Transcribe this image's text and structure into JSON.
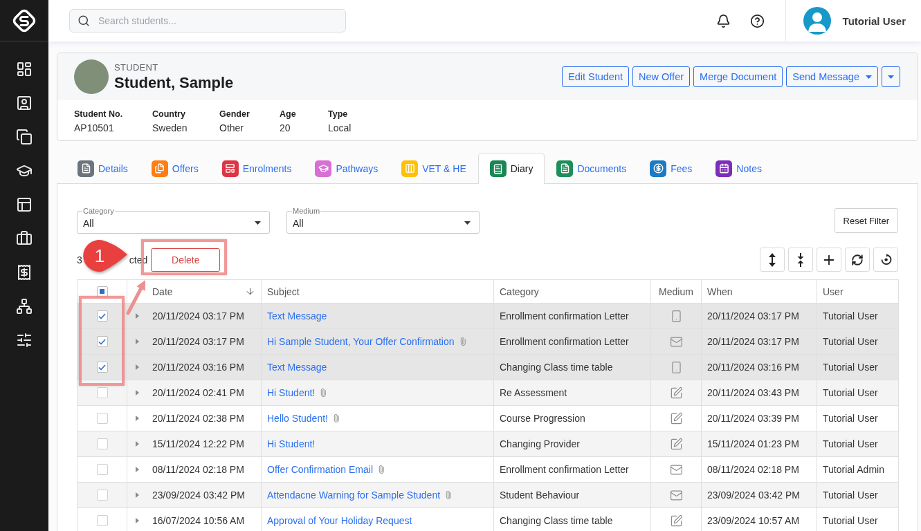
{
  "search": {
    "placeholder": "Search students..."
  },
  "user": {
    "name": "Tutorial User"
  },
  "student": {
    "label": "STUDENT",
    "name": "Student, Sample",
    "actions": [
      {
        "kind": "button",
        "label": "Edit Student"
      },
      {
        "kind": "button",
        "label": "New Offer"
      },
      {
        "kind": "button",
        "label": "Merge Document"
      },
      {
        "kind": "dropdown",
        "label": "Send Message"
      },
      {
        "kind": "toggle"
      }
    ],
    "fields": [
      {
        "label": "Student No.",
        "value": "AP10501"
      },
      {
        "label": "Country",
        "value": "Sweden"
      },
      {
        "label": "Gender",
        "value": "Other"
      },
      {
        "label": "Age",
        "value": "20"
      },
      {
        "label": "Type",
        "value": "Local"
      }
    ]
  },
  "tabs": [
    {
      "label": "Details",
      "selected": false,
      "color": "#6c757d"
    },
    {
      "label": "Offers",
      "selected": false,
      "color": "#fd7e14"
    },
    {
      "label": "Enrolments",
      "selected": false,
      "color": "#dc3545"
    },
    {
      "label": "Pathways",
      "selected": false,
      "color": "#d86fd3"
    },
    {
      "label": "VET & HE",
      "selected": false,
      "color": "#ffc107"
    },
    {
      "label": "Diary",
      "selected": true,
      "color": "#198754"
    },
    {
      "label": "Documents",
      "selected": false,
      "color": "#1e8e5a"
    },
    {
      "label": "Fees",
      "selected": false,
      "color": "#1b7cc4"
    },
    {
      "label": "Notes",
      "selected": false,
      "color": "#7d2eb8"
    }
  ],
  "filters": {
    "selects": [
      {
        "label": "Category",
        "value": "All"
      },
      {
        "label": "Medium",
        "value": "All"
      }
    ],
    "reset_label": "Reset Filter"
  },
  "selection": {
    "count": "3",
    "label_fragment": "cted"
  },
  "delete_label": "Delete",
  "annotation": {
    "step": "1"
  },
  "table": {
    "select_all": {
      "indeterminate": true
    },
    "columns": [
      {
        "label": "Date",
        "sorted": true
      },
      {
        "label": "Subject",
        "sorted": false
      },
      {
        "label": "Category",
        "sorted": false
      },
      {
        "label": "Medium",
        "sorted": false
      },
      {
        "label": "When",
        "sorted": false
      },
      {
        "label": "User",
        "sorted": false
      }
    ],
    "rows": [
      {
        "checked": true,
        "date": "20/11/2024 03:17 PM",
        "subject": "Text Message",
        "attachment": false,
        "category": "Enrollment confirmation Letter",
        "medium": {
          "kind": "phone"
        },
        "when": "20/11/2024 03:17 PM",
        "user": "Tutorial User"
      },
      {
        "checked": true,
        "date": "20/11/2024 03:17 PM",
        "subject": "Hi Sample Student, Your Offer Confirmation",
        "attachment": true,
        "category": "Enrollment confirmation Letter",
        "medium": {
          "kind": "email"
        },
        "when": "20/11/2024 03:17 PM",
        "user": "Tutorial User"
      },
      {
        "checked": true,
        "date": "20/11/2024 03:16 PM",
        "subject": "Text Message",
        "attachment": false,
        "category": "Changing Class time table",
        "medium": {
          "kind": "phone"
        },
        "when": "20/11/2024 03:16 PM",
        "user": "Tutorial User"
      },
      {
        "checked": false,
        "date": "20/11/2024 02:41 PM",
        "subject": "Hi Student!",
        "attachment": true,
        "category": "Re Assessment",
        "medium": {
          "kind": "note"
        },
        "when": "20/11/2024 03:43 PM",
        "user": "Tutorial User"
      },
      {
        "checked": false,
        "date": "20/11/2024 02:38 PM",
        "subject": "Hello Student!",
        "attachment": true,
        "category": "Course Progression",
        "medium": {
          "kind": "note"
        },
        "when": "20/11/2024 03:39 PM",
        "user": "Tutorial User"
      },
      {
        "checked": false,
        "date": "15/11/2024 12:22 PM",
        "subject": "Hi Student!",
        "attachment": false,
        "category": "Changing Provider",
        "medium": {
          "kind": "note"
        },
        "when": "15/11/2024 01:23 PM",
        "user": "Tutorial User"
      },
      {
        "checked": false,
        "date": "08/11/2024 02:18 PM",
        "subject": "Offer Confirmation Email",
        "attachment": true,
        "category": "Enrollment confirmation Letter",
        "medium": {
          "kind": "email"
        },
        "when": "08/11/2024 02:18 PM",
        "user": "Tutorial Admin"
      },
      {
        "checked": false,
        "date": "23/09/2024 03:42 PM",
        "subject": "Attendacne Warning for Sample Student",
        "attachment": true,
        "category": "Student Behaviour",
        "medium": {
          "kind": "email"
        },
        "when": "23/09/2024 03:42 PM",
        "user": "Tutorial User"
      },
      {
        "checked": false,
        "date": "16/07/2024 10:56 AM",
        "subject": "Approval of Your Holiday Request",
        "attachment": false,
        "category": "Changing Class time table",
        "medium": {
          "kind": "note"
        },
        "when": "23/09/2024 10:57 AM",
        "user": "Tutorial User"
      }
    ]
  }
}
